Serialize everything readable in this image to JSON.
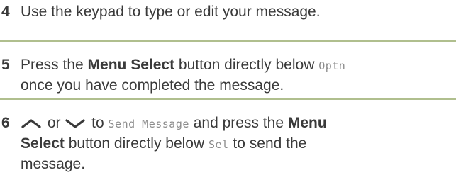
{
  "steps": [
    {
      "number": "4",
      "text": "Use the keypad to type or edit your message."
    },
    {
      "number": "5",
      "pre": "Press the ",
      "bold1": "Menu Select",
      "mid": " button directly below ",
      "mono1": "Optn",
      "line2": "once you have completed the message."
    },
    {
      "number": "6",
      "up_icon": "up-arrow-icon",
      "or_text": " or ",
      "down_icon": "down-arrow-icon",
      "to_text": " to ",
      "mono1": "Send Message",
      "and_text": " and press the ",
      "bold1": "Menu",
      "bold2": "Select",
      "mid2": " button directly below ",
      "mono2": "Sel",
      "tail": " to send the",
      "line3": "message."
    }
  ],
  "colors": {
    "text": "#3a3a3a",
    "divider": "#b0bf8e",
    "mono": "#8c8c8c"
  }
}
